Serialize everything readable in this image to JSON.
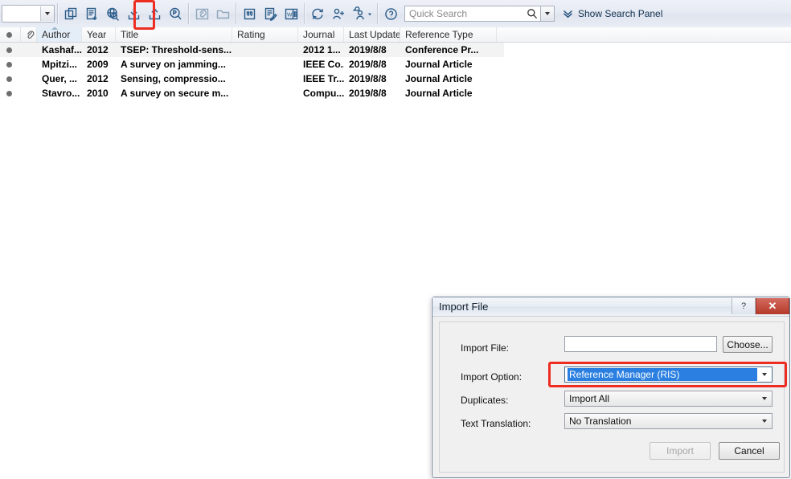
{
  "toolbar": {
    "library_select_value": "",
    "buttons": [
      {
        "name": "copy-references-icon",
        "title": "Copy References"
      },
      {
        "name": "new-reference-icon",
        "title": "New Reference"
      },
      {
        "name": "online-search-icon",
        "title": "Online Search"
      },
      {
        "name": "import-icon",
        "title": "Import"
      },
      {
        "name": "export-icon",
        "title": "Export"
      },
      {
        "name": "find-full-text-pdf-icon",
        "title": "Find Full Text"
      },
      {
        "name": "attach-file-icon",
        "title": "Attach File"
      },
      {
        "name": "open-file-icon",
        "title": "Open File"
      },
      {
        "name": "insert-citation-icon",
        "title": "Insert Citation"
      },
      {
        "name": "format-bibliography-icon",
        "title": "Format Bibliography"
      },
      {
        "name": "cite-while-you-write-icon",
        "title": "Cite While You Write"
      },
      {
        "name": "sync-icon",
        "title": "Sync"
      },
      {
        "name": "share-library-icon",
        "title": "Share Library"
      },
      {
        "name": "share-group-icon",
        "title": "Share Group"
      },
      {
        "name": "help-icon",
        "title": "Help"
      }
    ],
    "quick_search_placeholder": "Quick Search",
    "search_icon": "search-icon",
    "search_dropdown_icon": "chevron-down-icon",
    "show_search_panel_label": "Show Search Panel",
    "show_search_panel_icon": "double-chevron-down-icon",
    "highlight_color": "#ee2c22",
    "highlighted_button": "import-icon"
  },
  "table": {
    "columns": [
      {
        "key": "dot",
        "label": ""
      },
      {
        "key": "clip",
        "label": ""
      },
      {
        "key": "author",
        "label": "Author"
      },
      {
        "key": "year",
        "label": "Year"
      },
      {
        "key": "title",
        "label": "Title"
      },
      {
        "key": "rating",
        "label": "Rating"
      },
      {
        "key": "journal",
        "label": "Journal"
      },
      {
        "key": "updated",
        "label": "Last Updated"
      },
      {
        "key": "reftype",
        "label": "Reference Type"
      }
    ],
    "sorted_column": "Author",
    "sort_direction": "ascending",
    "rows": [
      {
        "author": "Kashaf...",
        "year": "2012",
        "title": "TSEP: Threshold-sens...",
        "rating": "",
        "journal": "2012 1...",
        "updated": "2019/8/8",
        "reftype": "Conference Pr...",
        "selected": true
      },
      {
        "author": "Mpitzi...",
        "year": "2009",
        "title": "A survey on jamming...",
        "rating": "",
        "journal": "IEEE Co...",
        "updated": "2019/8/8",
        "reftype": "Journal Article",
        "selected": false
      },
      {
        "author": "Quer, ...",
        "year": "2012",
        "title": "Sensing, compressio...",
        "rating": "",
        "journal": "IEEE Tr...",
        "updated": "2019/8/8",
        "reftype": "Journal Article",
        "selected": false
      },
      {
        "author": "Stavro...",
        "year": "2010",
        "title": "A survey on secure m...",
        "rating": "",
        "journal": "Compu...",
        "updated": "2019/8/8",
        "reftype": "Journal Article",
        "selected": false
      }
    ]
  },
  "dialog": {
    "title": "Import File",
    "help_button_label": "?",
    "close_button_label": "✕",
    "fields": {
      "import_file_label": "Import File:",
      "import_file_value": "",
      "choose_button_label": "Choose...",
      "import_option_label": "Import Option:",
      "import_option_value": "Reference Manager (RIS)",
      "duplicates_label": "Duplicates:",
      "duplicates_value": "Import All",
      "text_translation_label": "Text Translation:",
      "text_translation_value": "No Translation"
    },
    "buttons": {
      "import_label": "Import",
      "import_disabled": true,
      "cancel_label": "Cancel"
    },
    "highlight_color": "#ee2c22",
    "highlighted_field": "import-option-select"
  }
}
